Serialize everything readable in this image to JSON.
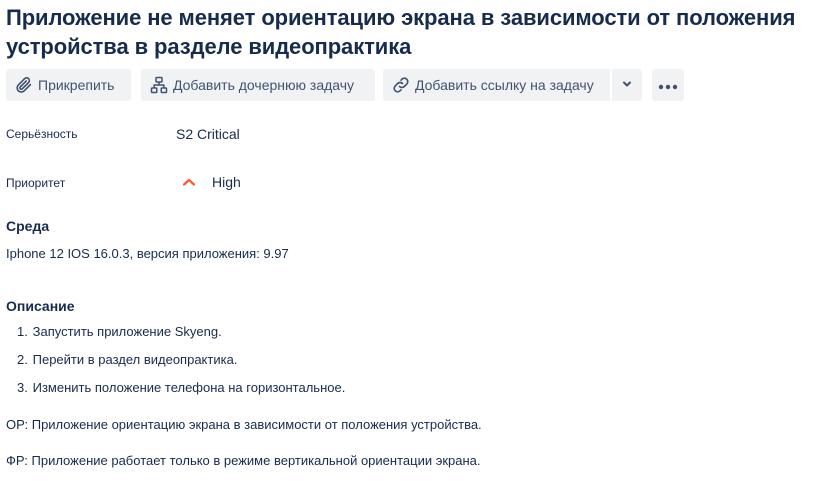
{
  "issue": {
    "title": "Приложение не меняет ориентацию экрана в зависимости от положения устройства в разделе видеопрактика"
  },
  "toolbar": {
    "attach_label": "Прикрепить",
    "add_child_label": "Добавить дочернюю задачу",
    "link_issue_label": "Добавить ссылку на задачу"
  },
  "fields": {
    "severity_label": "Серьёзность",
    "severity_value": "S2 Critical",
    "priority_label": "Приоритет",
    "priority_value": "High",
    "priority_color": "#ff5630"
  },
  "environment": {
    "heading": "Среда",
    "text": "Iphone 12 IOS 16.0.3, версия приложения: 9.97"
  },
  "description": {
    "heading": "Описание",
    "steps": [
      {
        "num": "1.",
        "text": "Запустить приложение Skyeng."
      },
      {
        "num": "2.",
        "text": "Перейти в раздел видеопрактика."
      },
      {
        "num": "3.",
        "text": "Изменить положение телефона на горизонтальное."
      }
    ],
    "expected": "ОР: Приложение ориентацию экрана в зависимости от положения устройства.",
    "actual": "ФР: Приложение работает только в режиме вертикальной ориентации экрана."
  }
}
